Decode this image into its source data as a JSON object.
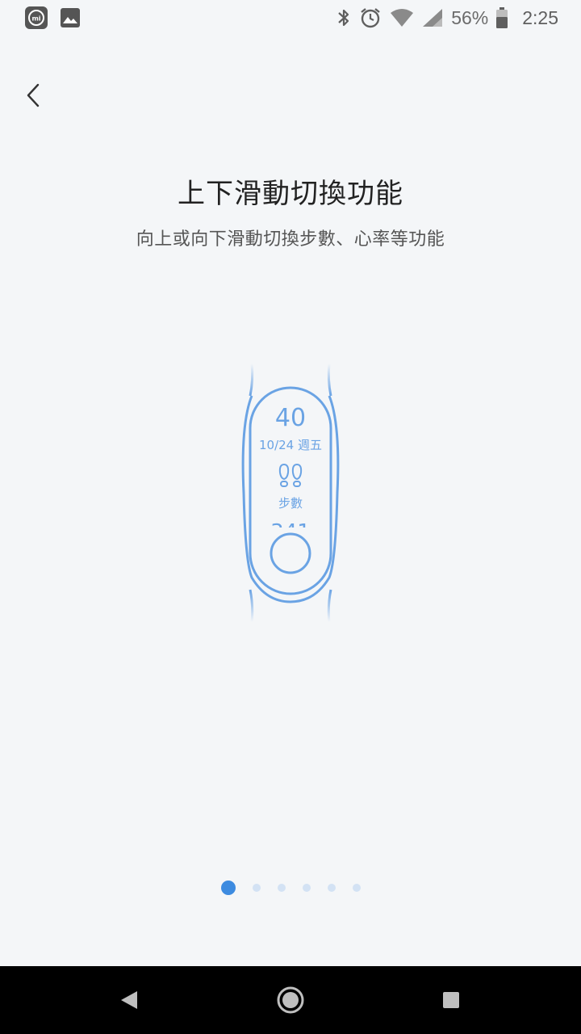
{
  "status_bar": {
    "battery_percent": "56%",
    "time": "2:25",
    "left_icons": [
      "mi-app-icon",
      "image-icon"
    ],
    "right_icons": [
      "bluetooth-icon",
      "alarm-icon",
      "wifi-icon",
      "signal-icon",
      "battery-icon"
    ]
  },
  "header": {
    "back_icon": "chevron-left-icon"
  },
  "main": {
    "title": "上下滑動切換功能",
    "subtitle": "向上或向下滑動切換步數、心率等功能"
  },
  "band_screen": {
    "date": "10/24 週五",
    "steps_label": "步數",
    "steps_icon": "footprints-icon"
  },
  "pager": {
    "total": 6,
    "active_index": 0
  },
  "nav_bar": {
    "buttons": [
      "back-triangle-icon",
      "home-circle-icon",
      "recents-square-icon"
    ]
  },
  "colors": {
    "accent": "#3d8be0",
    "band_stroke": "#6aa3e4",
    "background": "#f4f6f8"
  }
}
